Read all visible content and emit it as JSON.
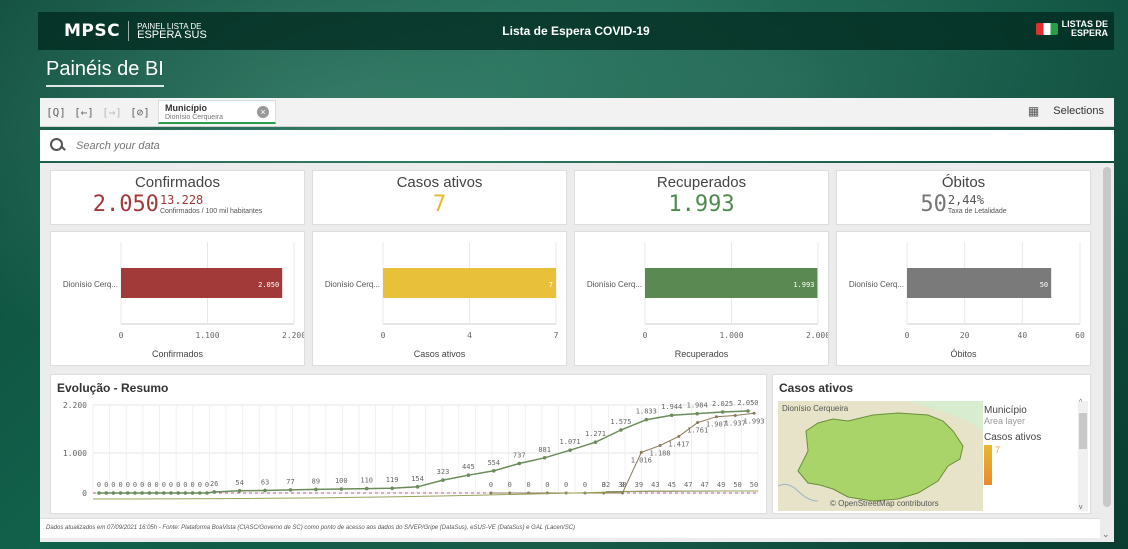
{
  "header": {
    "logo_main": "MPSC",
    "logo_sub_line1": "PAINEL LISTA DE",
    "logo_sub_line2": "ESPERA SUS",
    "title": "Lista de Espera   COVID-19",
    "brand_line1": "LISTAS DE",
    "brand_line2": "ESPERA"
  },
  "page_title": "Painéis de BI",
  "selection_bar": {
    "chip_label": "Município",
    "chip_value": "Dionísio Cerqueira",
    "selections_label": "Selections"
  },
  "search": {
    "placeholder": "Search your data"
  },
  "kpis": [
    {
      "title": "Confirmados",
      "value": "2.050",
      "sup_value": "13.228",
      "sup_note": "Confirmados / 100 mil habitantes",
      "color": "#a23a3a"
    },
    {
      "title": "Casos ativos",
      "value": "7",
      "sup_value": "",
      "sup_note": "",
      "color": "#e8b92e"
    },
    {
      "title": "Recuperados",
      "value": "1.993",
      "sup_value": "",
      "sup_note": "",
      "color": "#4e8a4e"
    },
    {
      "title": "Óbitos",
      "value": "50",
      "sup_value": "2,44%",
      "sup_note": "Taxa de Letalidade",
      "color": "#777777"
    }
  ],
  "bar_charts": [
    {
      "category": "Dionísio Cerq...",
      "value": 2050,
      "value_label": "2.050",
      "max": 2200,
      "ticks": [
        "0",
        "1.100",
        "2.200"
      ],
      "xlabel": "Confirmados",
      "color": "#a23a3a"
    },
    {
      "category": "Dionísio Cerq...",
      "value": 7,
      "value_label": "7",
      "max": 7,
      "ticks": [
        "0",
        "4",
        "7"
      ],
      "xlabel": "Casos ativos",
      "color": "#e8c03a"
    },
    {
      "category": "Dionísio Cerq...",
      "value": 1993,
      "value_label": "1.993",
      "max": 2000,
      "ticks": [
        "0",
        "1.000",
        "2.000"
      ],
      "xlabel": "Recuperados",
      "color": "#5a8a52"
    },
    {
      "category": "Dionísio Cerq...",
      "value": 50,
      "value_label": "50",
      "max": 60,
      "ticks": [
        "0",
        "20",
        "40",
        "60"
      ],
      "xlabel": "Óbitos",
      "color": "#7a7a7a"
    }
  ],
  "evolucao": {
    "title": "Evolução - Resumo",
    "y_ticks": [
      "2.200",
      "1.000",
      "0"
    ],
    "confirmados_labels": [
      "0",
      "0",
      "0",
      "0",
      "0",
      "0",
      "0",
      "0",
      "0",
      "0",
      "0",
      "0",
      "0",
      "0",
      "0",
      "0",
      "26",
      "54",
      "63",
      "77",
      "89",
      "100",
      "110",
      "119",
      "154",
      "323",
      "445",
      "554",
      "737",
      "881",
      "1.071",
      "1.271",
      "1.575",
      "1.833",
      "1.944",
      "1.984",
      "2.025",
      "2.050"
    ],
    "recuperados_labels": [
      "0",
      "0",
      "0",
      "0",
      "0",
      "0",
      "0",
      "0",
      "1.016",
      "1.188",
      "1.417",
      "1.761",
      "1.907",
      "1.937",
      "1.993"
    ],
    "obitos_labels": [
      "32",
      "38",
      "39",
      "43",
      "45",
      "47",
      "47",
      "49",
      "50",
      "50"
    ]
  },
  "chart_data": {
    "type": "line",
    "title": "Evolução - Resumo",
    "ylim": [
      0,
      2200
    ],
    "series": [
      {
        "name": "Confirmados",
        "values": [
          0,
          0,
          0,
          0,
          0,
          0,
          0,
          0,
          0,
          0,
          0,
          0,
          0,
          0,
          0,
          0,
          26,
          54,
          63,
          77,
          89,
          100,
          110,
          119,
          154,
          323,
          445,
          554,
          737,
          881,
          1071,
          1271,
          1575,
          1833,
          1944,
          1984,
          2025,
          2050
        ]
      },
      {
        "name": "Recuperados",
        "values": [
          0,
          0,
          0,
          0,
          0,
          0,
          0,
          0,
          1016,
          1188,
          1417,
          1761,
          1907,
          1937,
          1993
        ]
      },
      {
        "name": "Óbitos",
        "values": [
          32,
          38,
          39,
          43,
          45,
          47,
          47,
          49,
          50,
          50
        ]
      }
    ]
  },
  "map": {
    "title": "Casos ativos",
    "place_label": "Dionísio Cerqueira",
    "legend_title": "Município",
    "legend_sub": "Area layer",
    "legend_measure": "Casos ativos",
    "legend_value": "7",
    "attribution": "© OpenStreetMap contributors"
  },
  "footer": "Dados atualizados em 07/09/2021 16:05h - Fonte: Plataforma BoaVista (CIASC/Governo de SC) como ponto de acesso aos dados do SIVEP/Gripe (DataSus), eSUS-VE (DataSus) e GAL (Lacen/SC)"
}
